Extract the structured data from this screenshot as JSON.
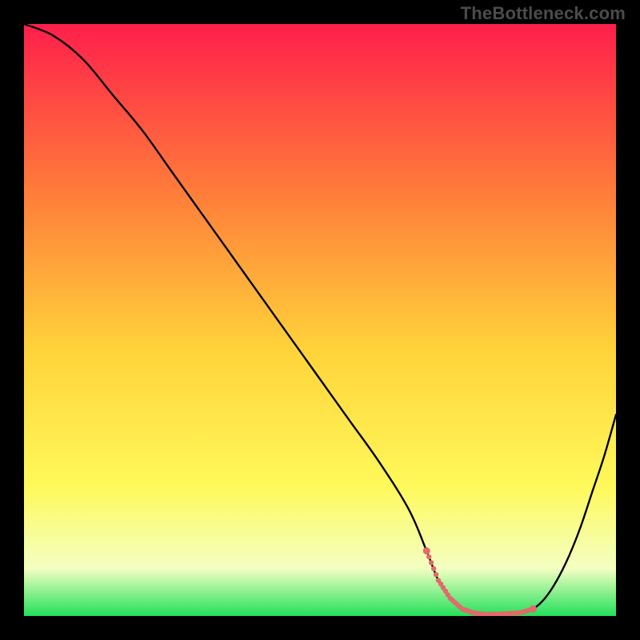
{
  "watermark": "TheBottleneck.com",
  "chart_data": {
    "type": "line",
    "title": "",
    "xlabel": "",
    "ylabel": "",
    "xlim": [
      0,
      100
    ],
    "ylim": [
      0,
      100
    ],
    "grid": false,
    "legend": false,
    "series": [
      {
        "name": "curve",
        "color": "#000000",
        "x": [
          0,
          5,
          10,
          15,
          20,
          25,
          30,
          35,
          40,
          45,
          50,
          55,
          60,
          65,
          68,
          70,
          72,
          74,
          76,
          78,
          80,
          82,
          84,
          86,
          88,
          90,
          92,
          94,
          96,
          98,
          100
        ],
        "values": [
          100,
          98,
          94,
          88,
          82,
          75,
          68,
          61,
          54,
          47,
          40,
          33,
          26,
          18,
          11,
          6,
          3,
          1.2,
          0.5,
          0.3,
          0.3,
          0.4,
          0.6,
          1.2,
          3,
          6,
          10,
          15,
          21,
          27,
          34
        ]
      },
      {
        "name": "dotted-accent",
        "color": "#e26a6a",
        "style": "dotted",
        "x": [
          68,
          70,
          72,
          74,
          76,
          78,
          80,
          82,
          84,
          86
        ],
        "values": [
          11,
          6,
          3,
          1.2,
          0.5,
          0.3,
          0.3,
          0.4,
          0.6,
          1.2
        ]
      }
    ],
    "background_gradient": {
      "top": "#ff1f4b",
      "mid1": "#ff7b3a",
      "mid2": "#ffd33a",
      "mid3": "#fff95a",
      "mid4": "#f3ffc2",
      "bottom": "#23e05a"
    }
  },
  "colors": {
    "page_bg": "#000000",
    "watermark": "#4b4b4b"
  }
}
